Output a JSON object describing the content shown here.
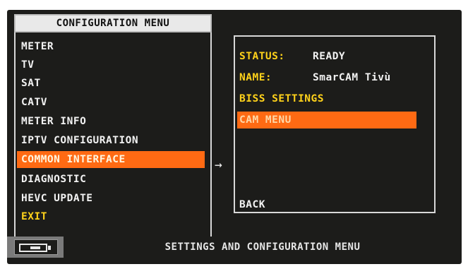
{
  "config_menu": {
    "title": "CONFIGURATION MENU",
    "items": [
      {
        "label": "METER"
      },
      {
        "label": "TV"
      },
      {
        "label": "SAT"
      },
      {
        "label": "CATV"
      },
      {
        "label": "METER INFO"
      },
      {
        "label": "IPTV CONFIGURATION"
      },
      {
        "label": "COMMON INTERFACE",
        "selected": true
      },
      {
        "label": "DIAGNOSTIC"
      },
      {
        "label": "HEVC UPDATE"
      },
      {
        "label": "EXIT"
      }
    ]
  },
  "arrow_glyph": "→",
  "cam_panel": {
    "status_label": "STATUS:",
    "status_value": "READY",
    "name_label": "NAME:",
    "name_value": "SmarCAM Tivù",
    "biss_settings": "BISS SETTINGS",
    "cam_menu": "CAM MENU",
    "back": "BACK"
  },
  "status_bar": {
    "text": "SETTINGS AND CONFIGURATION MENU",
    "battery_icon": "battery-icon"
  },
  "colors": {
    "highlight": "#ff6a13",
    "accent_yellow": "#ffd21a",
    "background": "#1c1c1a"
  }
}
